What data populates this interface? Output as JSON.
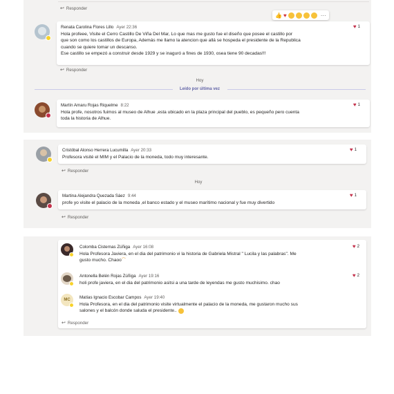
{
  "top_block": {
    "reply_label": "Responder",
    "reactions_bar": {
      "icons": [
        "thumbs-up-icon",
        "heart-icon",
        "laugh-icon",
        "surprised-icon",
        "sad-icon",
        "angry-icon",
        "more-options-icon"
      ]
    },
    "message": {
      "author": "Renata Carolina Flores Lillo",
      "time": "Ayer 22:36",
      "likes": "1",
      "lines": [
        "Hola profeee, Visite el Cerro Castillo De Viña Del Mar, Lo que mas me gusto fue el diseño que posee el castillo por",
        "que son como los castillos de Europa, Además me llamo la atencion que allá se hospeda el presidente de la Republica",
        "cuando se quiere tomar un descanso.",
        "Ese castillo se empezó a construir desde 1929 y se inaguró a fines de 1930, osea tiene 90 decadas!!!"
      ],
      "reply_label": "Responder"
    },
    "today_label": "Hoy",
    "last_read_label": "Leído por última vez",
    "message2": {
      "author": "Martín Amaru Rojas Riquelme",
      "time": "8:22",
      "likes": "1",
      "lines": [
        "Hola profe, nosotros fuimos al museo de Alhue ,esta ubicado en la plaza principal del pueblo, es pequeño pero cuenta",
        "toda la historia de Alhue."
      ]
    }
  },
  "middle_block": {
    "message1": {
      "author": "Cristóbal Alonso Herrera Lucumilla",
      "time": "Ayer 20:33",
      "likes": "1",
      "text": "Profesora visité el MIM y el Palacio de la moneda, todo muy interesante.",
      "reply_label": "Responder"
    },
    "today_label": "Hoy",
    "message2": {
      "author": "Martina Alejandra Quezada Sáez",
      "time": "9:44",
      "likes": "1",
      "text": "profe yo visite el palacio de la moneda ,el banco estado y el museo marítimo nacional y fue muy divertido",
      "reply_label": "Responder"
    }
  },
  "bottom_block": {
    "messages": [
      {
        "author": "Colomba Cisternas Zúñiga",
        "time": "Ayer 16:08",
        "likes": "2",
        "lines": [
          "Hola Profesora Javiera, en el dia del patrimonio vi la historia de Gabriela Mistral \" Lucila y las palabras\". Me",
          "gusto mucho. Chaoo"
        ]
      },
      {
        "author": "Antonella Belén Rojas Zúñiga",
        "time": "Ayer 19:16",
        "likes": "2",
        "lines": [
          "holi profe javiera, en el dia del patrimonio asitsi a una tarde de leyendas me gusto muchisimo. chao"
        ]
      },
      {
        "author": "Matías Ignacio Escobar Campos",
        "time": "Ayer 19:40",
        "initials": "MC",
        "likes": "",
        "lines": [
          "Hola Profesora, en el dia del patrimonio visite virtualmente el palacio de la moneda, me gustaron mucho sus",
          "salones y el balcón donde saluda el presidente.."
        ]
      }
    ],
    "reply_label": "Responder"
  },
  "colors": {
    "accent": "#6264a7",
    "heart": "#c4314b",
    "panel": "#f3f2f1",
    "away": "#f8d22a"
  }
}
